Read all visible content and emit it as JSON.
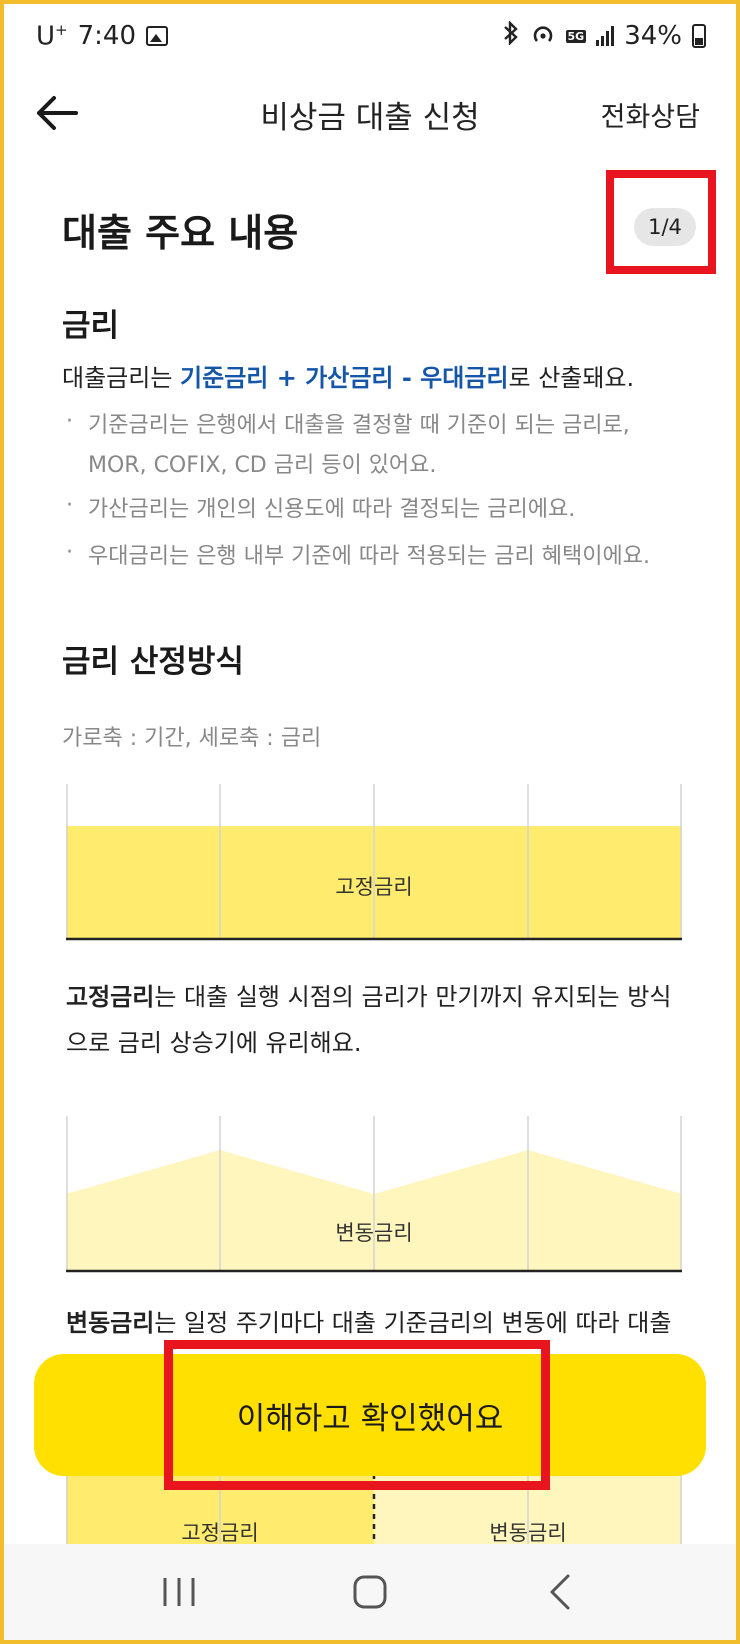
{
  "status_bar": {
    "carrier": "U",
    "carrier_sup": "+",
    "time": "7:40",
    "network": "5G",
    "battery": "34%"
  },
  "header": {
    "title": "비상금 대출 신청",
    "phone_consult": "전화상담"
  },
  "main": {
    "section_title": "대출 주요 내용",
    "page_indicator": "1/4",
    "rate": {
      "heading": "금리",
      "intro_prefix": "대출금리는 ",
      "intro_accent": "기준금리 + 가산금리 - 우대금리",
      "intro_suffix": "로 산출돼요.",
      "bullets": [
        "기준금리는 은행에서 대출을 결정할 때 기준이 되는 금리로, MOR, COFIX, CD 금리 등이 있어요.",
        "가산금리는 개인의 신용도에 따라 결정되는 금리에요.",
        "우대금리는 은행 내부 기준에 따라 적용되는 금리 혜택이에요."
      ]
    },
    "calc": {
      "heading": "금리 산정방식",
      "axis_note": "가로축 : 기간, 세로축 : 금리"
    },
    "fixed": {
      "chart_label": "고정금리",
      "desc_bold": "고정금리",
      "desc_rest": "는 대출 실행 시점의 금리가 만기까지 유지되는 방식으로 금리 상승기에 유리해요."
    },
    "variable": {
      "chart_label": "변동금리",
      "desc_bold": "변동금리",
      "desc_rest": "는 일정 주기마다 대출 기준금리의 변동에 따라 대출금리가 변경되는 방식으로 금리 하락기에 유리해요."
    },
    "mixed": {
      "left_label": "고정금리",
      "right_label": "변동금리"
    }
  },
  "cta": {
    "label": "이해하고 확인했어요"
  },
  "colors": {
    "accent_blue": "#1456A8",
    "cta_yellow": "#FFE000",
    "fixed_fill": "#FFEB6E",
    "variable_fill": "#FFF6BE",
    "highlight_red": "#E8141E"
  }
}
